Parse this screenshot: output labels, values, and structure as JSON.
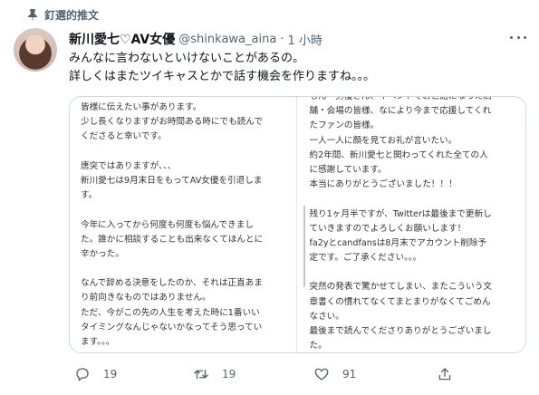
{
  "pinned": {
    "label": "釘選的推文"
  },
  "author": {
    "name": "新川愛七♡AV女優",
    "handle": "@shinkawa_aina",
    "separator": "·",
    "time": "1 小時"
  },
  "tweet": {
    "lines": [
      "みんなに言わないといけないことがあるの。",
      "詳しくはまたツイキャスとかで話す機会を作りますね。。。"
    ]
  },
  "media": {
    "left_lines": [
      "皆様に伝えたい事があります。",
      "少し長くなりますがお時間ある時にでも読んで",
      "くださると幸いです。",
      "",
      "唐突ではありますが、、、",
      "新川愛七は9月末日をもってAV女優を引退しま",
      "す。",
      "",
      "今年に入ってから何度も何度も悩んできまし",
      "た。誰かに相談することも出来なくてほんとに",
      "辛かった。",
      "",
      "なんで辞める決意をしたのか、それは正直あま",
      "り前向きなものではありません。",
      "ただ、今がこの先の人生を考えた時に1番いい",
      "タイミングなんじゃないかなってそう思ってい",
      "ます。。。"
    ],
    "right_lines": [
      "もん・男優さん、イベントでお世話になった店",
      "舗・会場の皆様、なにより今まで応援してくれ",
      "たファンの皆様。",
      "一人一人に顔を見てお礼が言いたい。",
      "約2年間、新川愛七と関わってくれた全ての人",
      "に感謝しています。",
      "本当にありがとうございました！！！",
      "",
      "残り1ヶ月半ですが、Twitterは最後まで更新し",
      "ていきますのでよろしくお願いします！",
      "fa2yとcandfansは8月末でアカウント削除予",
      "定です。ご了承ください。。。",
      "",
      "突然の発表で驚かせてしまい、またこういう文",
      "章書くの慣れてなくてまとまりがなくてごめん",
      "なさい。",
      "最後まで読んでくださりありがとうございまし",
      "た。"
    ]
  },
  "actions": {
    "replies": "19",
    "retweets": "19",
    "likes": "91"
  },
  "icons": [
    "pin-icon",
    "more-icon",
    "reply-icon",
    "retweet-icon",
    "like-icon",
    "share-icon"
  ]
}
